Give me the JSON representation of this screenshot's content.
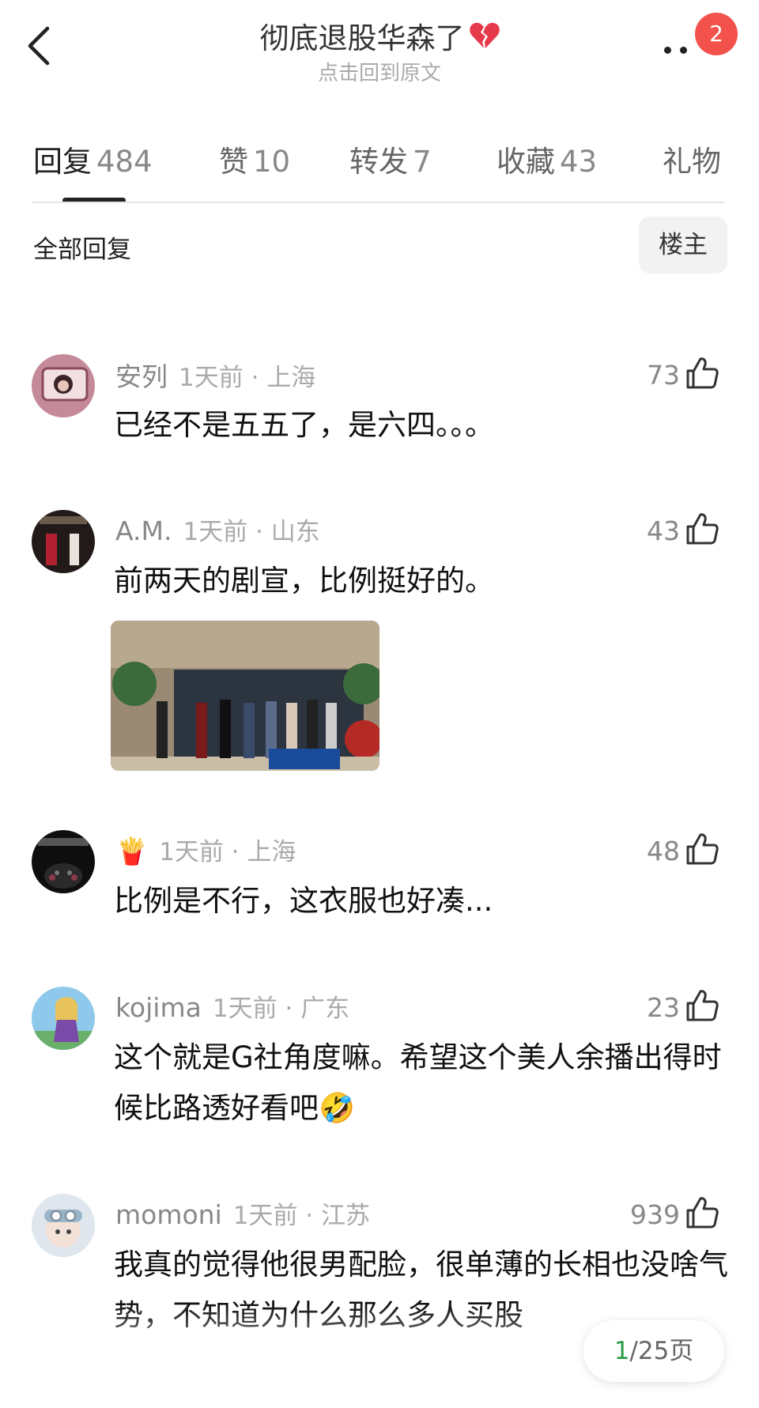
{
  "header": {
    "title": "彻底退股华森了",
    "subtitle": "点击回到原文",
    "notification_count": "2",
    "back_icon": "chevron-left-icon",
    "more_icon": "more-dots-icon"
  },
  "tabs": [
    {
      "label": "回复",
      "count": "484",
      "active": true
    },
    {
      "label": "赞",
      "count": "10"
    },
    {
      "label": "转发",
      "count": "7"
    },
    {
      "label": "收藏",
      "count": "43"
    },
    {
      "label": "礼物",
      "count": ""
    }
  ],
  "filter": {
    "all_replies": "全部回复",
    "op_only": "楼主"
  },
  "comments": [
    {
      "user": "安列",
      "time": "1天前 · 上海",
      "likes": "73",
      "text": "已经不是五五了，是六四。。。"
    },
    {
      "user": "A.M.",
      "time": "1天前 · 山东",
      "likes": "43",
      "text": "前两天的剧宣，比例挺好的。",
      "attachment": "image"
    },
    {
      "user": "🍟",
      "time": "1天前 · 上海",
      "likes": "48",
      "text": "比例是不行，这衣服也好凑..."
    },
    {
      "user": "kojima",
      "time": "1天前 · 广东",
      "likes": "23",
      "text": "这个就是G社角度嘛。希望这个美人余播出得时候比路透好看吧🤣"
    },
    {
      "user": "momoni",
      "time": "1天前 · 江苏",
      "likes": "939",
      "text": "我真的觉得他很男配脸，很单薄的长相也没啥气势，不知道为什么那么多人买股"
    }
  ],
  "pager": {
    "current": "1",
    "total": "/25页"
  },
  "colors": {
    "accent_red": "#f2524b",
    "pager_current": "#2a9a45"
  }
}
